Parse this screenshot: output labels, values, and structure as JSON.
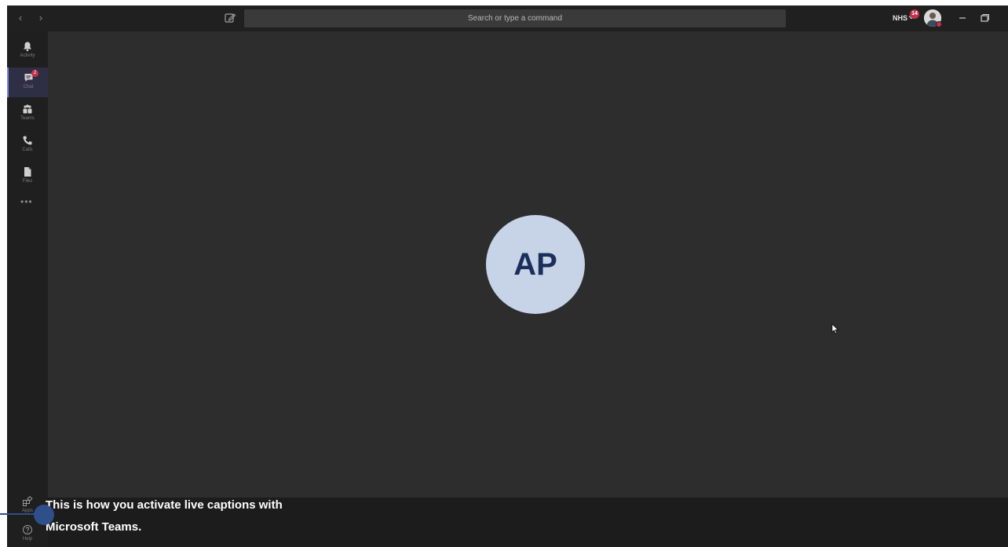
{
  "titlebar": {
    "back_icon": "chevron-left-icon",
    "forward_icon": "chevron-right-icon",
    "compose_icon": "compose-icon",
    "search_placeholder": "Search or type a command",
    "org_label": "NHS",
    "notification_count": "14"
  },
  "rail": {
    "items": [
      {
        "label": "Activity",
        "icon": "bell-icon"
      },
      {
        "label": "Chat",
        "icon": "chat-icon",
        "badge": "2",
        "active": true
      },
      {
        "label": "Teams",
        "icon": "teams-icon"
      },
      {
        "label": "Calls",
        "icon": "phone-icon"
      },
      {
        "label": "Files",
        "icon": "file-icon"
      }
    ],
    "more": "•••",
    "bottom": [
      {
        "label": "Apps",
        "icon": "apps-icon"
      },
      {
        "label": "Help",
        "icon": "help-icon"
      }
    ]
  },
  "stage": {
    "participant_initials": "AP"
  },
  "caption": {
    "line1": "This is how you activate live captions with",
    "line2": "Microsoft Teams."
  },
  "colors": {
    "stage": "#2d2d2d",
    "rail": "#1f1f1f",
    "avatar_bg": "#c7d3e6",
    "avatar_text": "#1b2f5c",
    "badge": "#c4314b",
    "pointer": "#2f4f8a"
  }
}
